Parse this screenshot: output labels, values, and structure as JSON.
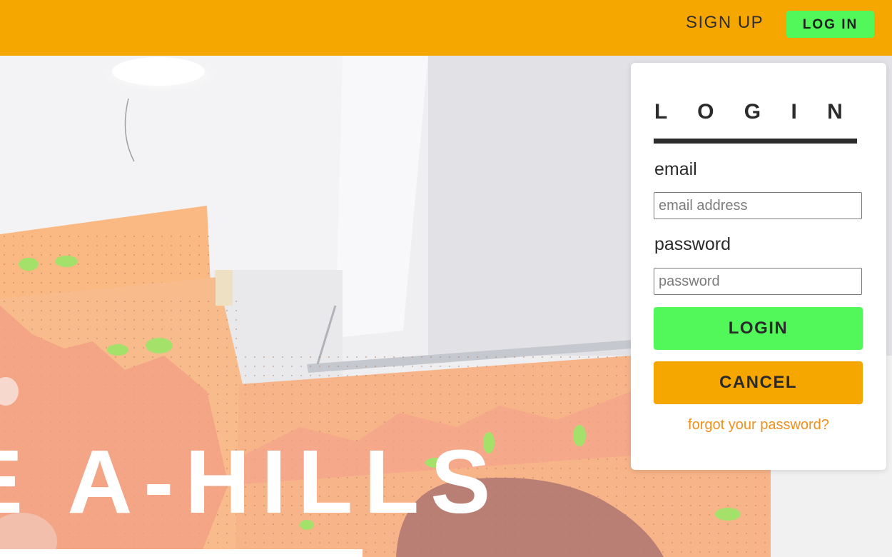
{
  "nav": {
    "signup_label": "SIGN UP",
    "login_label": "LOG IN"
  },
  "hero": {
    "title": "E A-HILLS"
  },
  "login_panel": {
    "heading": "L O G I N",
    "email_label": "email",
    "email_placeholder": "email address",
    "email_value": "",
    "password_label": "password",
    "password_placeholder": "password",
    "password_value": "",
    "login_button": "LOGIN",
    "cancel_button": "CANCEL",
    "forgot_link": "forgot your password?"
  },
  "colors": {
    "brand_orange": "#f5a700",
    "accent_green": "#52f75a",
    "link_orange": "#ef8f1c",
    "text_dark": "#2b2b2b"
  }
}
